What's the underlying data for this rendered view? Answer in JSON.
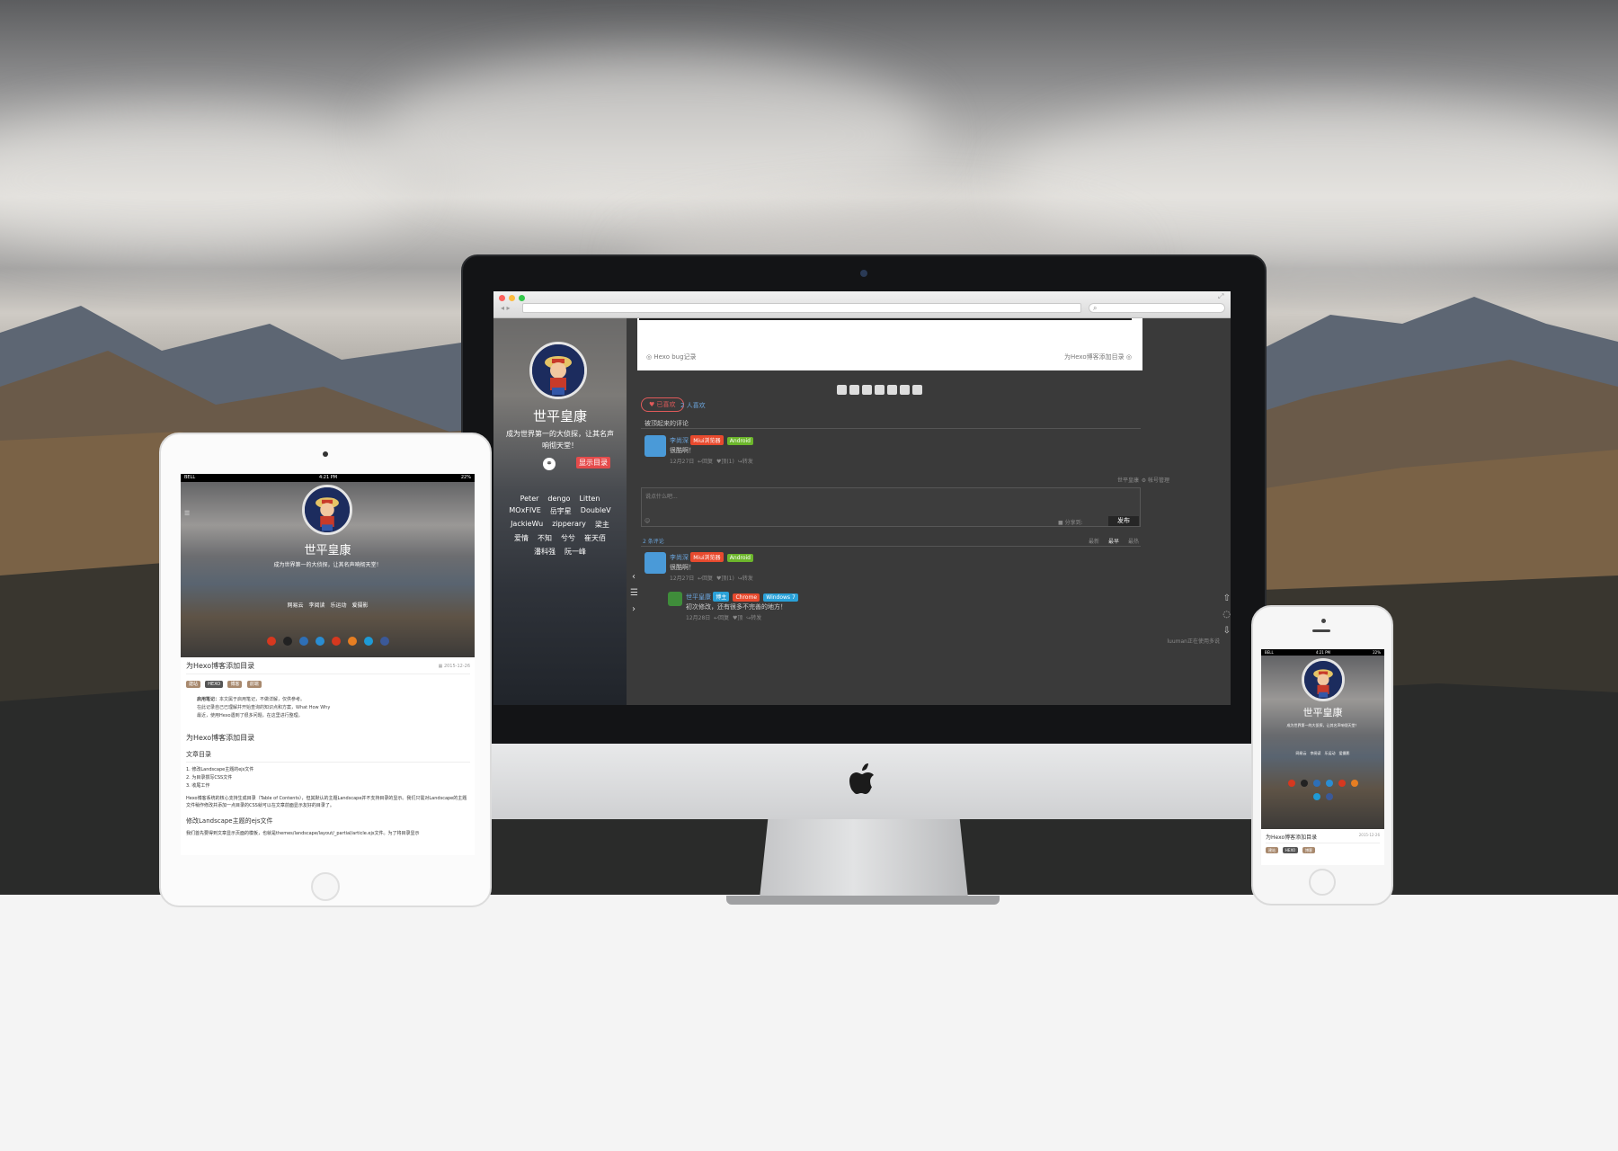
{
  "blog": {
    "author": "世平皇康",
    "motto": "成为世界第一的大侦探，让其名声响彻天堂！",
    "toc_button": "显示目录",
    "friends": [
      "Peter",
      "dengo",
      "Litten",
      "MOxFIVE",
      "岳宇星",
      "DoubleV",
      "JackieWu",
      "zipperary",
      "梁主",
      "爱情",
      "不知",
      "兮兮",
      "崔天佰",
      "潘科强",
      "阮一峰"
    ]
  },
  "desktop": {
    "prev_article": "Hexo bug记录",
    "next_article": "为Hexo博客添加目录",
    "like_button": "已喜欢",
    "like_count": "2 人喜欢",
    "hot_comments_title": "被顶起来的评论",
    "comment1": {
      "user": "李尚深",
      "browser": "Miui浏览器",
      "os": "Android",
      "text": "很酷啊！",
      "time": "12月27日",
      "reply": "回复",
      "upvote": "顶(1)",
      "share": "转发"
    },
    "login_user": "世平皇康",
    "account_manage": "帐号管理",
    "textarea_placeholder": "说点什么吧...",
    "share_to": "分享到:",
    "publish": "发布",
    "comment_count": "2 条评论",
    "sort_tabs": [
      "最新",
      "最早",
      "最热"
    ],
    "comment2": {
      "user": "李尚深",
      "browser": "Miui浏览器",
      "os": "Android",
      "text": "很酷啊！",
      "time": "12月27日",
      "reply": "回复",
      "upvote": "顶(1)",
      "share": "转发"
    },
    "reply1": {
      "user": "世平皇康",
      "role": "博主",
      "browser": "Chrome",
      "os": "Windows 7",
      "text": "初次修改，还有很多不完善的地方！",
      "time": "12月28日",
      "reply": "回复",
      "upvote": "顶",
      "share": "转发"
    },
    "powered": "luuman正在使用多说"
  },
  "ipad": {
    "carrier": "BELL",
    "time": "4:21 PM",
    "battery": "22%",
    "nav": [
      "网易云",
      "李阅读",
      "乐运动",
      "爱摄影"
    ],
    "article_title": "为Hexo博客添加目录",
    "date": "2015-12-26",
    "tags": [
      "建站",
      "HEXO",
      "博客",
      "前端"
    ],
    "intro_label": "启用笔记：",
    "intro": "本文属于启用笔记，不做详解，仅供参考。",
    "intro2": "在此记录自己已理解并开始查询的知识点和方案，What How Why",
    "intro3": "最近，使用Hexo遇到了很多问题，在这里进行整理。",
    "h1": "为Hexo博客添加目录",
    "toc_heading": "文章目录",
    "toc": [
      "1.  修改Landscape主题的ejs文件",
      "2.  为目录撰写CSS文件",
      "3.  收尾工作"
    ],
    "para": "Hexo博客系统的核心支持生成目录（Table of Contents），但其默认的主题Landscape并不支持目录的显示。我们只需对Landscape的主题文件稍作修改并添加一点目录的CSS就可以在文章前面显示友好的目录了。",
    "h2": "修改Landscape主题的ejs文件",
    "para2": "我们首先要得到文章显示页面的模板，也就是themes/landscape/layout/_partial/article.ejs文件。为了将目录显示"
  },
  "iphone": {
    "carrier": "BELL",
    "time": "4:21 PM",
    "battery": "22%",
    "nav": [
      "网易云",
      "李阅读",
      "乐运动",
      "爱摄影"
    ],
    "article_title": "为Hexo博客添加目录",
    "date": "2015-12-26",
    "tags": [
      "建站",
      "HEXO",
      "博客"
    ]
  },
  "colors": {
    "accent_red": "#e54b4b",
    "badge_red": "#e84a2e",
    "badge_green": "#6cb62b",
    "badge_blue": "#2aa1d8",
    "link_blue": "#6aa3d9"
  }
}
